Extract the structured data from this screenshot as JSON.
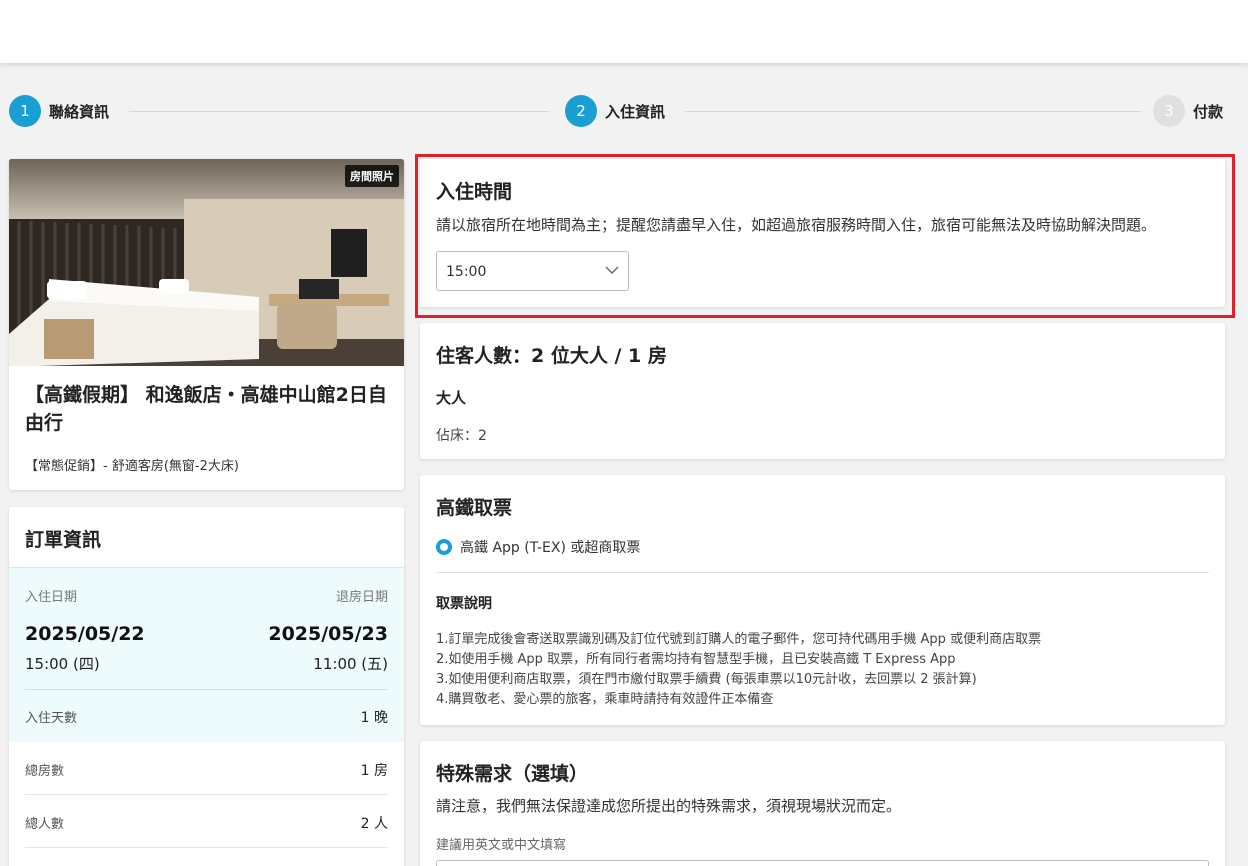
{
  "stepper": {
    "steps": [
      {
        "number": "1",
        "label": "聯絡資訊"
      },
      {
        "number": "2",
        "label": "入住資訊"
      },
      {
        "number": "3",
        "label": "付款"
      }
    ]
  },
  "hotel": {
    "photo_badge": "房間照片",
    "title": "【高鐵假期】 和逸飯店・高雄中山館2日自由行",
    "room": "【常態促銷】- 舒適客房(無窗-2大床)"
  },
  "order": {
    "title": "訂單資訊",
    "checkin_label": "入住日期",
    "checkout_label": "退房日期",
    "checkin_date": "2025/05/22",
    "checkout_date": "2025/05/23",
    "checkin_time": "15:00 (四)",
    "checkout_time": "11:00 (五)",
    "nights_label": "入住天數",
    "nights_value": "1 晚",
    "rooms_label": "總房數",
    "rooms_value": "1 房",
    "people_label": "總人數",
    "people_value": "2 人"
  },
  "checkin": {
    "title": "入住時間",
    "description": "請以旅宿所在地時間為主；提醒您請盡早入住，如超過旅宿服務時間入住，旅宿可能無法及時協助解決問題。",
    "selected_time": "15:00"
  },
  "guests": {
    "title": "住客人數：2 位大人 / 1 房",
    "adult_label": "大人",
    "bed": "佔床：2"
  },
  "ticket": {
    "title": "高鐵取票",
    "option": "高鐵 App (T-EX) 或超商取票",
    "note_title": "取票說明",
    "notes": [
      "1.訂單完成後會寄送取票識別碼及訂位代號到訂購人的電子郵件，您可持代碼用手機 App 或便利商店取票",
      "2.如使用手機 App 取票，所有同行者需均持有智慧型手機，且已安裝高鐵 T Express App",
      "3.如使用便利商店取票，須在門市繳付取票手續費 (每張車票以10元計收，去回票以 2 張計算)",
      "4.購買敬老、愛心票的旅客，乘車時請持有效證件正本備查"
    ]
  },
  "special": {
    "title": "特殊需求（選填）",
    "description": "請注意，我們無法保證達成您所提出的特殊需求，須視現場狀況而定。",
    "hint": "建議用英文或中文填寫"
  },
  "colors": {
    "accent": "#1a9fd5",
    "highlight": "#e0202a",
    "dates_bg": "#eefbfd"
  }
}
